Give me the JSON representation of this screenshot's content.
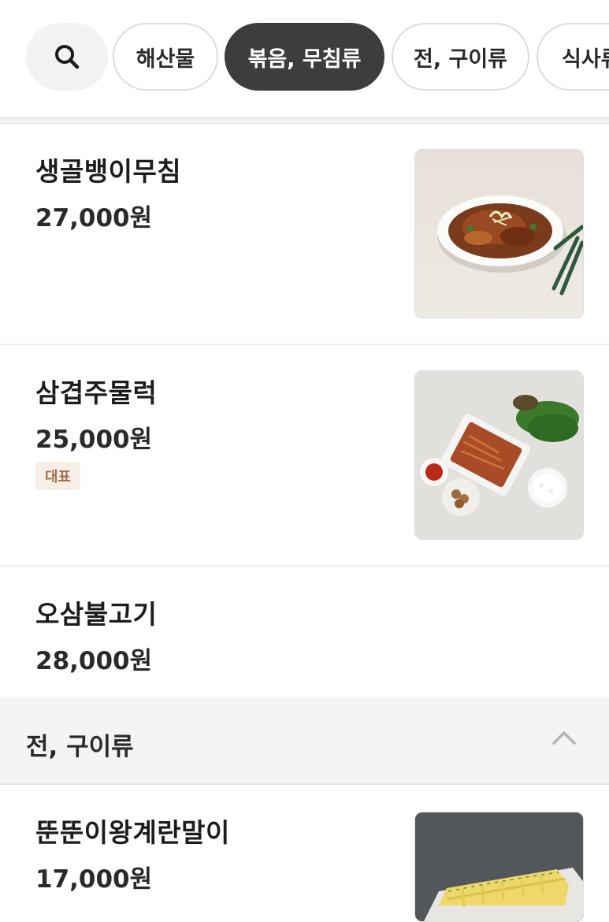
{
  "categories": {
    "search_icon": "search-icon",
    "chips": [
      {
        "label": "해산물",
        "active": false
      },
      {
        "label": "볶음, 무침류",
        "active": true
      },
      {
        "label": "전, 구이류",
        "active": false
      },
      {
        "label": "식사류",
        "active": false
      }
    ]
  },
  "menu": [
    {
      "name": "생골뱅이무침",
      "price": "27,000원",
      "badge": "",
      "has_image": true
    },
    {
      "name": "삼겹주물럭",
      "price": "25,000원",
      "badge": "대표",
      "has_image": true
    },
    {
      "name": "오삼불고기",
      "price": "28,000원",
      "badge": "",
      "has_image": false
    }
  ],
  "section": {
    "title": "전, 구이류",
    "toggle_icon": "chevron-up-icon",
    "items": [
      {
        "name": "뚠뚠이왕계란말이",
        "price": "17,000원",
        "has_image": true
      }
    ]
  },
  "colors": {
    "active_chip": "#3d3d3d",
    "badge_bg": "#f5efe8",
    "badge_text": "#a0704a",
    "section_bg": "#f4f4f4"
  }
}
